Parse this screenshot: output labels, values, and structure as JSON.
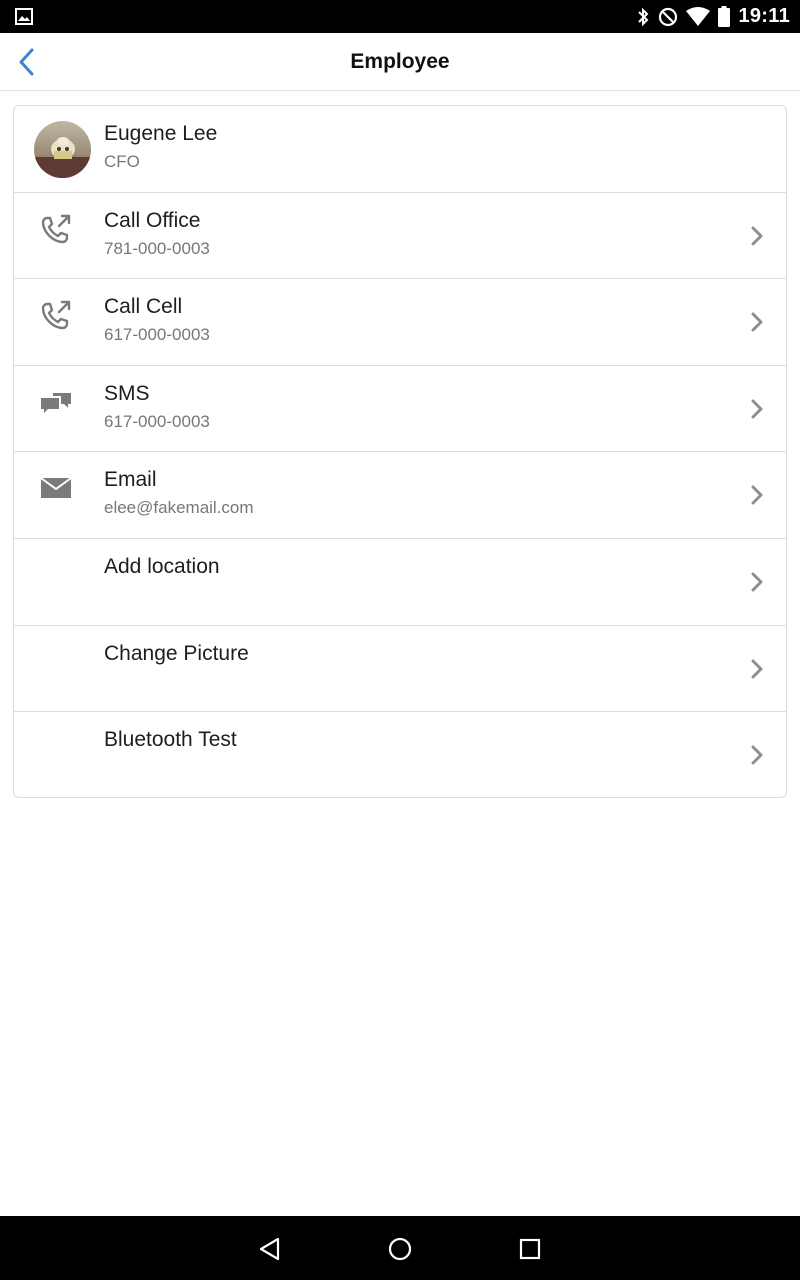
{
  "status_bar": {
    "time": "19:11",
    "icons": [
      "gallery-icon",
      "bluetooth-icon",
      "do-not-disturb-icon",
      "wifi-icon",
      "battery-icon"
    ]
  },
  "app_bar": {
    "title": "Employee",
    "back_icon": "chevron-left-icon",
    "accent_color": "#3a87d0"
  },
  "profile": {
    "name": "Eugene Lee",
    "title": "CFO"
  },
  "actions": [
    {
      "label": "Call Office",
      "value": "781-000-0003",
      "icon": "phone-outgoing-icon"
    },
    {
      "label": "Call Cell",
      "value": "617-000-0003",
      "icon": "phone-outgoing-icon"
    },
    {
      "label": "SMS",
      "value": "617-000-0003",
      "icon": "chat-bubbles-icon"
    },
    {
      "label": "Email",
      "value": "elee@fakemail.com",
      "icon": "envelope-icon"
    },
    {
      "label": "Add location",
      "value": "",
      "icon": ""
    },
    {
      "label": "Change Picture",
      "value": "",
      "icon": ""
    },
    {
      "label": "Bluetooth Test",
      "value": "",
      "icon": ""
    }
  ],
  "nav_bar": {
    "back": "triangle-back-icon",
    "home": "circle-home-icon",
    "recents": "square-recents-icon"
  }
}
